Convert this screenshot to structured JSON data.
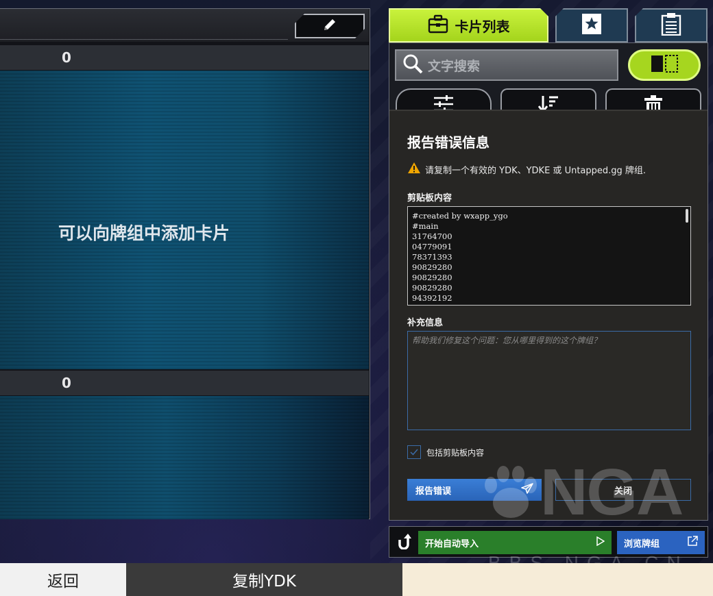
{
  "deck": {
    "main_count": "0",
    "empty_hint": "可以向牌组中添加卡片",
    "extra_count": "0"
  },
  "tabs": [
    {
      "label": "卡片列表",
      "icon": "briefcase-icon",
      "active": true
    },
    {
      "label": "",
      "icon": "bookmark-star-icon",
      "active": false
    },
    {
      "label": "",
      "icon": "clipboard-icon",
      "active": false
    }
  ],
  "search": {
    "placeholder": "文字搜索"
  },
  "dialog": {
    "title": "报告错误信息",
    "warning": "请复制一个有效的 YDK、YDKE 或 Untapped.gg 牌组.",
    "clipboard_label": "剪贴板内容",
    "clipboard_lines": [
      "#created by wxapp_ygo",
      "#main",
      "31764700",
      "04779091",
      "78371393",
      "90829280",
      "90829280",
      "90829280",
      "94392192"
    ],
    "notes_label": "补充信息",
    "notes_placeholder": "帮助我们修复这个问题：您从哪里得到的这个牌组？",
    "include_clipboard_label": "包括剪贴板内容",
    "include_clipboard_checked": true,
    "report_button": "报告错误",
    "close_button": "关闭"
  },
  "import_bar": {
    "auto_import": "开始自动导入",
    "browse_decks": "浏览牌组"
  },
  "watermark": {
    "main": "NGA",
    "sub": "BBS.NGA.CN"
  },
  "footer": {
    "back": "返回",
    "copy_ydk": "复制YDK"
  },
  "colors": {
    "accent_green": "#b4e02a",
    "report_blue": "#2f6fcc",
    "import_green": "#2a7f2a"
  }
}
